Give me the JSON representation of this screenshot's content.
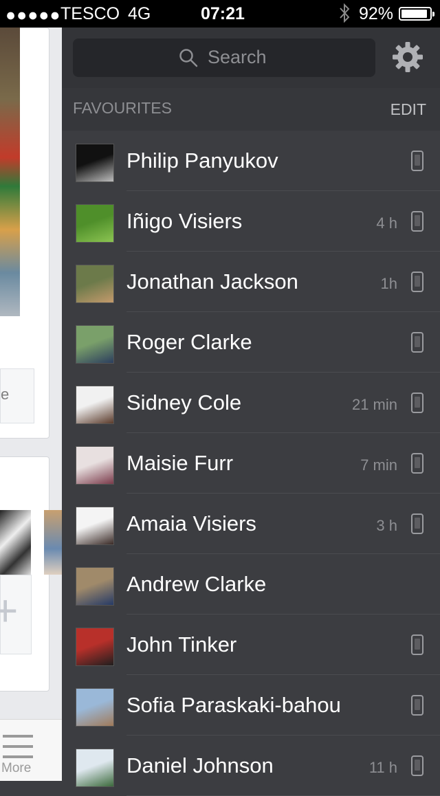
{
  "status_bar": {
    "signal": "●●●●●",
    "carrier": "TESCO",
    "network": "4G",
    "time": "07:21",
    "battery_text": "92%",
    "battery_level": 0.92
  },
  "background_app": {
    "button_fragment": "e",
    "more_label": "More"
  },
  "search": {
    "placeholder": "Search"
  },
  "favourites": {
    "title": "FAVOURITES",
    "edit_label": "EDIT",
    "contacts": [
      {
        "name": "Philip Panyukov",
        "time": "",
        "mobile": true,
        "avatar_colors": [
          "#111111",
          "#bdbdbd"
        ]
      },
      {
        "name": "Iñigo Visiers",
        "time": "4 h",
        "mobile": true,
        "avatar_colors": [
          "#4f8f2a",
          "#8cc452"
        ]
      },
      {
        "name": "Jonathan Jackson",
        "time": "1h",
        "mobile": true,
        "avatar_colors": [
          "#6c7a4a",
          "#c49a6c"
        ]
      },
      {
        "name": "Roger Clarke",
        "time": "",
        "mobile": true,
        "avatar_colors": [
          "#7aa06a",
          "#2c3e5e"
        ]
      },
      {
        "name": "Sidney Cole",
        "time": "21 min",
        "mobile": true,
        "avatar_colors": [
          "#f1f1f1",
          "#5a3a2a"
        ]
      },
      {
        "name": "Maisie Furr",
        "time": "7 min",
        "mobile": true,
        "avatar_colors": [
          "#e8e0e0",
          "#7a3a4a"
        ]
      },
      {
        "name": "Amaia Visiers",
        "time": "3 h",
        "mobile": true,
        "avatar_colors": [
          "#f4f4f4",
          "#3a2a26"
        ]
      },
      {
        "name": "Andrew Clarke",
        "time": "",
        "mobile": false,
        "avatar_colors": [
          "#a08a6a",
          "#263a66"
        ]
      },
      {
        "name": "John Tinker",
        "time": "",
        "mobile": true,
        "avatar_colors": [
          "#b8302a",
          "#1f1f1f"
        ]
      },
      {
        "name": "Sofia Paraskaki-bahou",
        "time": "",
        "mobile": true,
        "avatar_colors": [
          "#9ab8d8",
          "#a07a5a"
        ]
      },
      {
        "name": "Daniel Johnson",
        "time": "11 h",
        "mobile": true,
        "avatar_colors": [
          "#dfe8ef",
          "#3c6a3c"
        ]
      }
    ]
  }
}
